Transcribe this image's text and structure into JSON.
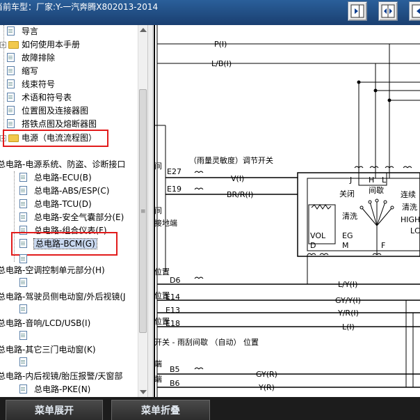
{
  "window": {
    "title": "当前车型：厂家:Y-一汽奔腾X802013-2014"
  },
  "toolbar": {
    "icons": [
      "pane-right-icon",
      "split-view-icon",
      "pane-left-icon"
    ]
  },
  "tree": {
    "items": [
      {
        "label": "导言",
        "kind": "page"
      },
      {
        "label": "如何使用本手册",
        "kind": "folder"
      },
      {
        "label": "故障排除",
        "kind": "page"
      },
      {
        "label": "缩写",
        "kind": "page"
      },
      {
        "label": "线束符号",
        "kind": "page"
      },
      {
        "label": "术语和符号表",
        "kind": "page"
      },
      {
        "label": "位置图及连接器图",
        "kind": "page"
      },
      {
        "label": "搭铁点图及熔断器图",
        "kind": "page"
      },
      {
        "label": "电源（电流流程图）",
        "kind": "folder"
      },
      {
        "label": "总电路-电源系统、防盗、诊断接口",
        "kind": "page"
      },
      {
        "label": "总电路-ECU(B)",
        "kind": "page"
      },
      {
        "label": "总电路-ABS/ESP(C)",
        "kind": "page"
      },
      {
        "label": "总电路-TCU(D)",
        "kind": "page"
      },
      {
        "label": "总电路-安全气囊部分(E)",
        "kind": "page"
      },
      {
        "label": "总电路-组合仪表(F)",
        "kind": "page"
      },
      {
        "label": "总电路-BCM(G)",
        "kind": "page"
      },
      {
        "label": "总电路-空调控制单元部分(H)",
        "kind": "page"
      },
      {
        "label": "总电路-驾驶员侧电动窗/外后视镜(J",
        "kind": "page"
      },
      {
        "label": "总电路-音响/LCD/USB(I)",
        "kind": "page"
      },
      {
        "label": "总电路-其它三门电动窗(K)",
        "kind": "page"
      },
      {
        "label": "总电路-内后视镜/胎压报警/天窗部",
        "kind": "page"
      },
      {
        "label": "总电路-PKE(N)",
        "kind": "page"
      }
    ],
    "selected": "总电路-BCM(G)"
  },
  "diagram": {
    "wire_labels": [
      "P(I)",
      "L/B(I)",
      "V(I)",
      "BR/R(I)",
      "L/Y(I)",
      "GY/Y(I)",
      "Y/R(I)",
      "L(I)",
      "GY(R)",
      "Y(R)"
    ],
    "pins": [
      "E27",
      "E19",
      "D6",
      "E14",
      "E13",
      "E18",
      "B5",
      "B6"
    ],
    "text_snippets": [
      "间",
      "间",
      "接地端",
      "位置",
      "位置",
      "位置",
      "开关 - 雨刮间歇 （自动） 位置",
      "端",
      "端"
    ],
    "switch_title": "（雨量灵敏度）调节开关",
    "switch_terminals": [
      "J",
      "H",
      "L",
      "VOL",
      "D",
      "EG",
      "M",
      "F"
    ],
    "switch_labels": [
      "关闭",
      "间歇",
      "连续",
      "清洗",
      "清洗",
      "HIGH",
      "LC"
    ]
  },
  "bottom": {
    "expand_label": "菜单展开",
    "collapse_label": "菜单折叠"
  }
}
